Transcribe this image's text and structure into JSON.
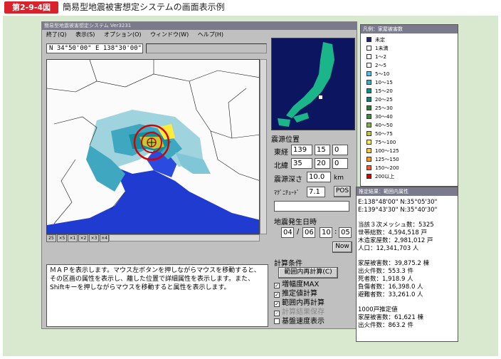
{
  "figure": {
    "label": "第2-9-4図",
    "title": "簡易型地震被害想定システムの画面表示例"
  },
  "app": {
    "window_title": "簡易型地震被害想定システム Ver3231",
    "menu": [
      "終了(Q)",
      "表示(S)",
      "オプション(O)",
      "ウィンドウ(W)",
      "ヘルプ(H)"
    ],
    "coord_readout": "N 34°50'00\" E 138°30'00\"",
    "zoom_buttons": [
      "25",
      "×5",
      "×1",
      "×2",
      "×3",
      "×4"
    ],
    "message": "ＭＡＰを表示します。マウス左ボタンを押しながらマウスを移動すると、その区画の属性を表示し、離した位置で詳細属性を表示します。また、Shiftキーを押しながらマウスを移動すると属性を表示します。",
    "epicenter": {
      "section_label": "震源位置",
      "lon_label": "東経",
      "lon_deg": "139",
      "lon_min": "15",
      "lon_sec": "0",
      "lat_label": "北緯",
      "lat_deg": "35",
      "lat_min": "20",
      "lat_sec": "0",
      "depth_label": "震源深さ",
      "depth_value": "10.0",
      "depth_unit": "km",
      "mag_label": "ﾏｸﾞﾆﾁｭｰﾄﾞ",
      "mag_value": "7.1",
      "pos_button": "POS"
    },
    "datetime": {
      "section_label": "地震発生日時",
      "month": "04",
      "day": "06",
      "hour": "10",
      "minute": "05",
      "sep_date": "/",
      "sep_time": ":",
      "now_button": "Now"
    },
    "calc": {
      "section_label": "計算条件",
      "recalc_button": "範囲内再計算(C)",
      "options": [
        {
          "label": "増幅度MAX",
          "checked": true,
          "disabled": false
        },
        {
          "label": "推定値計算",
          "checked": true,
          "disabled": false
        },
        {
          "label": "範囲内再計算",
          "checked": true,
          "disabled": false
        },
        {
          "label": "計算結果保存",
          "checked": true,
          "disabled": true
        },
        {
          "label": "基盤速度表示",
          "checked": false,
          "disabled": false
        }
      ]
    }
  },
  "legend": {
    "title": "凡例：家屋被害数",
    "items": [
      {
        "label": "未定",
        "color": "#1a237e"
      },
      {
        "label": "1未満",
        "color": "#ffffff"
      },
      {
        "label": "1～2",
        "color": "#ffffff"
      },
      {
        "label": "2～5",
        "color": "#ffffff"
      },
      {
        "label": "5～10",
        "color": "#4fc3f7"
      },
      {
        "label": "10～15",
        "color": "#29b6c6"
      },
      {
        "label": "15～20",
        "color": "#009688"
      },
      {
        "label": "20～25",
        "color": "#00897b"
      },
      {
        "label": "25～30",
        "color": "#2e7d32"
      },
      {
        "label": "30～40",
        "color": "#388e3c"
      },
      {
        "label": "40～50",
        "color": "#7cb342"
      },
      {
        "label": "50～75",
        "color": "#c0ca33"
      },
      {
        "label": "75～100",
        "color": "#ffeb3b"
      },
      {
        "label": "100～125",
        "color": "#ffca28"
      },
      {
        "label": "125～150",
        "color": "#ff9800"
      },
      {
        "label": "150～200",
        "color": "#ff5722"
      },
      {
        "label": "200以上",
        "color": "#d50000"
      }
    ]
  },
  "result": {
    "title": "推定結果：範囲内属性",
    "range1": "E:138°48'00\"  N:35°05'30\"",
    "range2": "E:139°43'30\"  N:35°40'30\"",
    "mesh": "当該３次メッシュ数：5325",
    "households": "世帯総数：4,594,518 戸",
    "wood": "木造家屋数：2,981,012 戸",
    "population": "人口：12,341,703 人",
    "damage_house": "家屋被害数：39,875.2 棟",
    "fire": "出火件数：553.3 件",
    "deaths": "死者数：1,918.9 人",
    "injured": "負傷者数：16,398.0 人",
    "evac": "避難者数：33,261.0 人",
    "sub_title": "1000戸推定値",
    "sub_damage": "家屋被害数：61,621 棟",
    "sub_fire": "出火件数：863.2 件"
  },
  "colors": {
    "brand_red": "#d9232c",
    "bg_green": "#d8e9cf",
    "sea": "#0c1660",
    "epicenter_ring": "#d50000"
  }
}
